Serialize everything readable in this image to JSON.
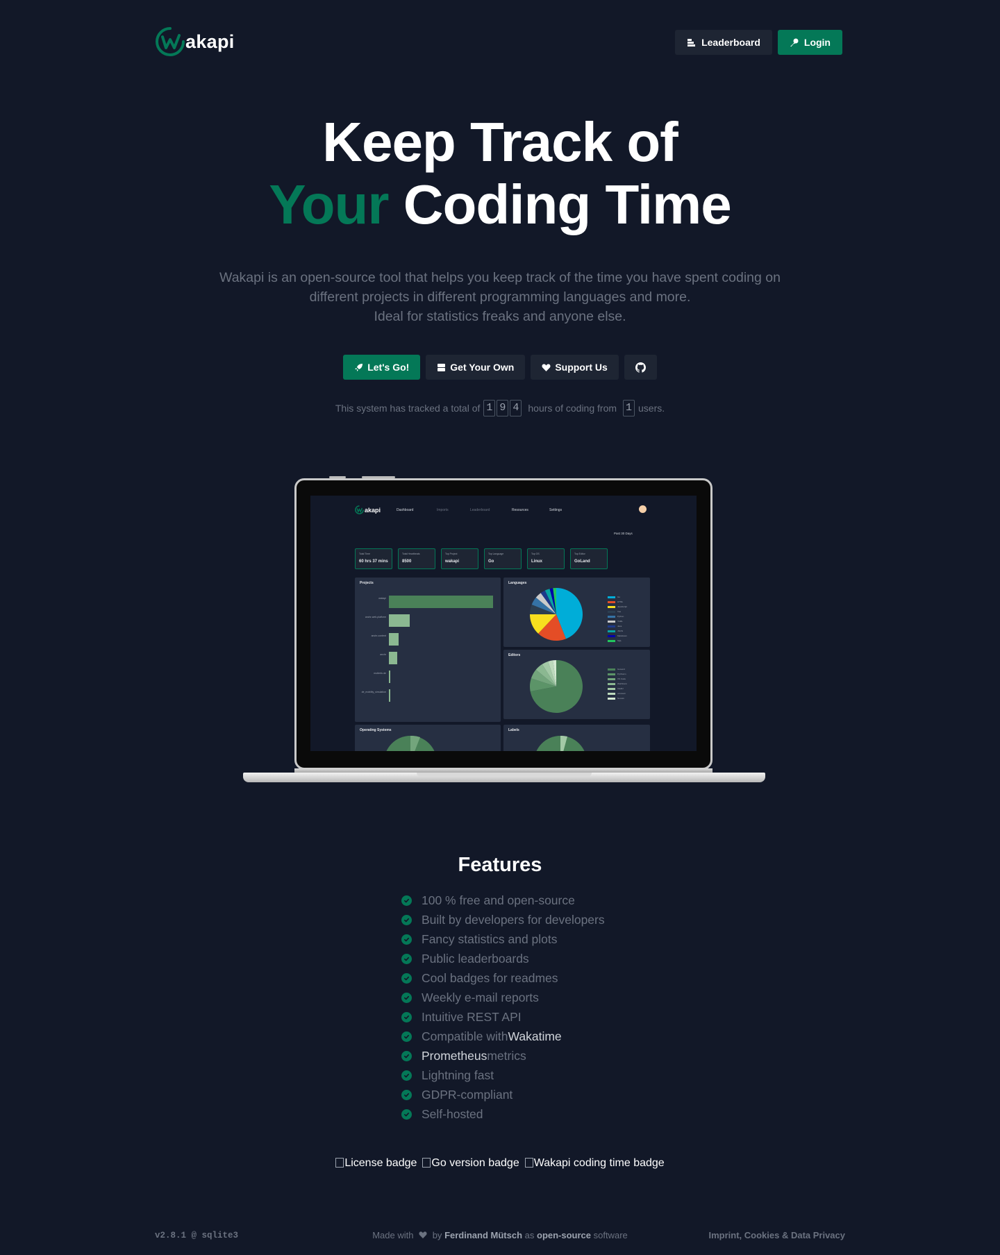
{
  "header": {
    "logo_text": "akapi",
    "leaderboard_label": "Leaderboard",
    "login_label": "Login"
  },
  "hero": {
    "title_line1": "Keep Track of",
    "title_accent": "Your",
    "title_line2_rest": "Coding Time",
    "lead_line1": "Wakapi is an open-source tool that helps you keep track of the time you have spent coding on",
    "lead_line2": "different projects in different programming languages and more.",
    "lead_line3": "Ideal for statistics freaks and anyone else."
  },
  "cta": {
    "lets_go": "Let's Go!",
    "get_your_own": "Get Your Own",
    "support_us": "Support Us"
  },
  "stats": {
    "prefix": "This system has tracked a total of",
    "hours_digits": [
      "1",
      "9",
      "4"
    ],
    "middle": "hours of coding from",
    "users_digits": [
      "1"
    ],
    "suffix": "users."
  },
  "preview": {
    "nav": {
      "logo": "akapi",
      "dashboard": "Dashboard",
      "imports": "Imports",
      "leaderboard": "Leaderboard",
      "resources": "Resources",
      "settings": "Settings"
    },
    "range": "Past 30 Days",
    "kpis": [
      {
        "label": "Total Time",
        "value": "60 hrs 37 mins"
      },
      {
        "label": "Total Heartbeats",
        "value": "8500"
      },
      {
        "label": "Top Project",
        "value": "wakapi"
      },
      {
        "label": "Top Language",
        "value": "Go"
      },
      {
        "label": "Top OS",
        "value": "Linux"
      },
      {
        "label": "Top Editor",
        "value": "GoLand"
      }
    ],
    "panels": {
      "projects": "Projects",
      "languages": "Languages",
      "editors": "Editors",
      "os": "Operating Systems",
      "labels": "Labels"
    },
    "projects": [
      {
        "name": "wakapi",
        "share": 1.0
      },
      {
        "name": "anchr-web-platform",
        "share": 0.2
      },
      {
        "name": "anchr-content",
        "share": 0.09
      },
      {
        "name": "anchr",
        "share": 0.08
      },
      {
        "name": "mutterfu.de",
        "share": 0.015
      },
      {
        "name": "de_mobility_simulation",
        "share": 0.012
      }
    ],
    "languages": [
      {
        "name": "Go",
        "color": "#00ADD8",
        "share": 0.44
      },
      {
        "name": "HTML",
        "color": "#E44D26",
        "share": 0.18
      },
      {
        "name": "JavaScript",
        "color": "#F7DF1E",
        "share": 0.13
      },
      {
        "name": "Vue",
        "color": "#2c3e50",
        "share": 0.06
      },
      {
        "name": "Python",
        "color": "#3572A5",
        "share": 0.05
      },
      {
        "name": "YAML",
        "color": "#cbcbcb",
        "share": 0.04
      },
      {
        "name": "Java",
        "color": "#1e3a8a",
        "share": 0.03
      },
      {
        "name": "JSON",
        "color": "#09a3a3",
        "share": 0.03
      },
      {
        "name": "Markdown",
        "color": "#0000aa",
        "share": 0.02
      },
      {
        "name": "SQL",
        "color": "#22c55e",
        "share": 0.02
      }
    ],
    "editors": [
      {
        "name": "GoLand",
        "color": "#4a8158",
        "share": 0.72
      },
      {
        "name": "PyCharm",
        "color": "#5c9468",
        "share": 0.08
      },
      {
        "name": "VS Code",
        "color": "#73a57c",
        "share": 0.06
      },
      {
        "name": "WebStorm",
        "color": "#8bb891",
        "share": 0.05
      },
      {
        "name": "IntelliJ",
        "color": "#a3c9a6",
        "share": 0.04
      },
      {
        "name": "unknown",
        "color": "#bcdabc",
        "share": 0.03
      },
      {
        "name": "Neovim",
        "color": "#d4ead3",
        "share": 0.02
      }
    ]
  },
  "features": {
    "title": "Features",
    "items": [
      {
        "pre": "100 % free and open-source",
        "hl": "",
        "post": ""
      },
      {
        "pre": "Built by developers for developers",
        "hl": "",
        "post": ""
      },
      {
        "pre": "Fancy statistics and plots",
        "hl": "",
        "post": ""
      },
      {
        "pre": "Public leaderboards",
        "hl": "",
        "post": ""
      },
      {
        "pre": "Cool badges for readmes",
        "hl": "",
        "post": ""
      },
      {
        "pre": "Weekly e-mail reports",
        "hl": "",
        "post": ""
      },
      {
        "pre": "Intuitive REST API",
        "hl": "",
        "post": ""
      },
      {
        "pre": "Compatible with ",
        "hl": "Wakatime",
        "post": ""
      },
      {
        "pre": "",
        "hl": "Prometheus",
        "post": " metrics"
      },
      {
        "pre": "Lightning fast",
        "hl": "",
        "post": ""
      },
      {
        "pre": "GDPR-compliant",
        "hl": "",
        "post": ""
      },
      {
        "pre": "Self-hosted",
        "hl": "",
        "post": ""
      }
    ]
  },
  "badges": [
    "License badge",
    "Go version badge",
    "Wakapi coding time badge"
  ],
  "footer": {
    "version": "v2.8.1 @ sqlite3",
    "made_with": "Made with",
    "by": "by",
    "author": "Ferdinand Mütsch",
    "as": "as",
    "open_source": "open-source",
    "software": "software",
    "legal": "Imprint, Cookies & Data Privacy"
  },
  "colors": {
    "background": "#121828",
    "accent": "#047857",
    "muted_text": "#6b7280",
    "button_dark": "#1e2533"
  }
}
